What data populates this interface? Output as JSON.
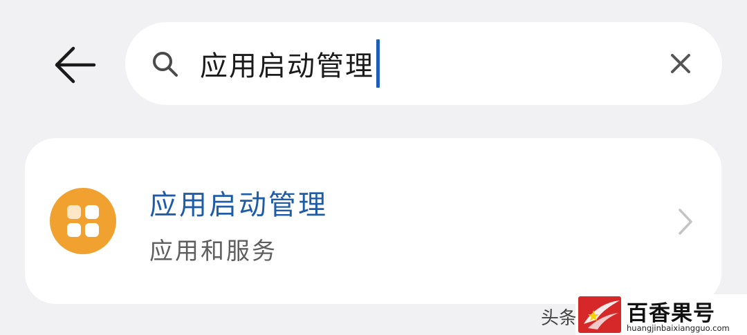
{
  "header": {
    "back_icon": "arrow-left-icon"
  },
  "search": {
    "icon": "search-icon",
    "query": "应用启动管理",
    "clear_icon": "close-icon",
    "caret_color": "#1e5eb9"
  },
  "results": [
    {
      "icon": "app-grid-icon",
      "icon_color": "#f0a130",
      "title": "应用启动管理",
      "title_color": "#1f5ca8",
      "subtitle": "应用和服务",
      "chevron_icon": "chevron-right-icon"
    }
  ],
  "watermark": {
    "left_text": "头条",
    "name": "百香果号",
    "url": "huangjinbaixiangguo.com",
    "logo_color": "#d62828"
  }
}
